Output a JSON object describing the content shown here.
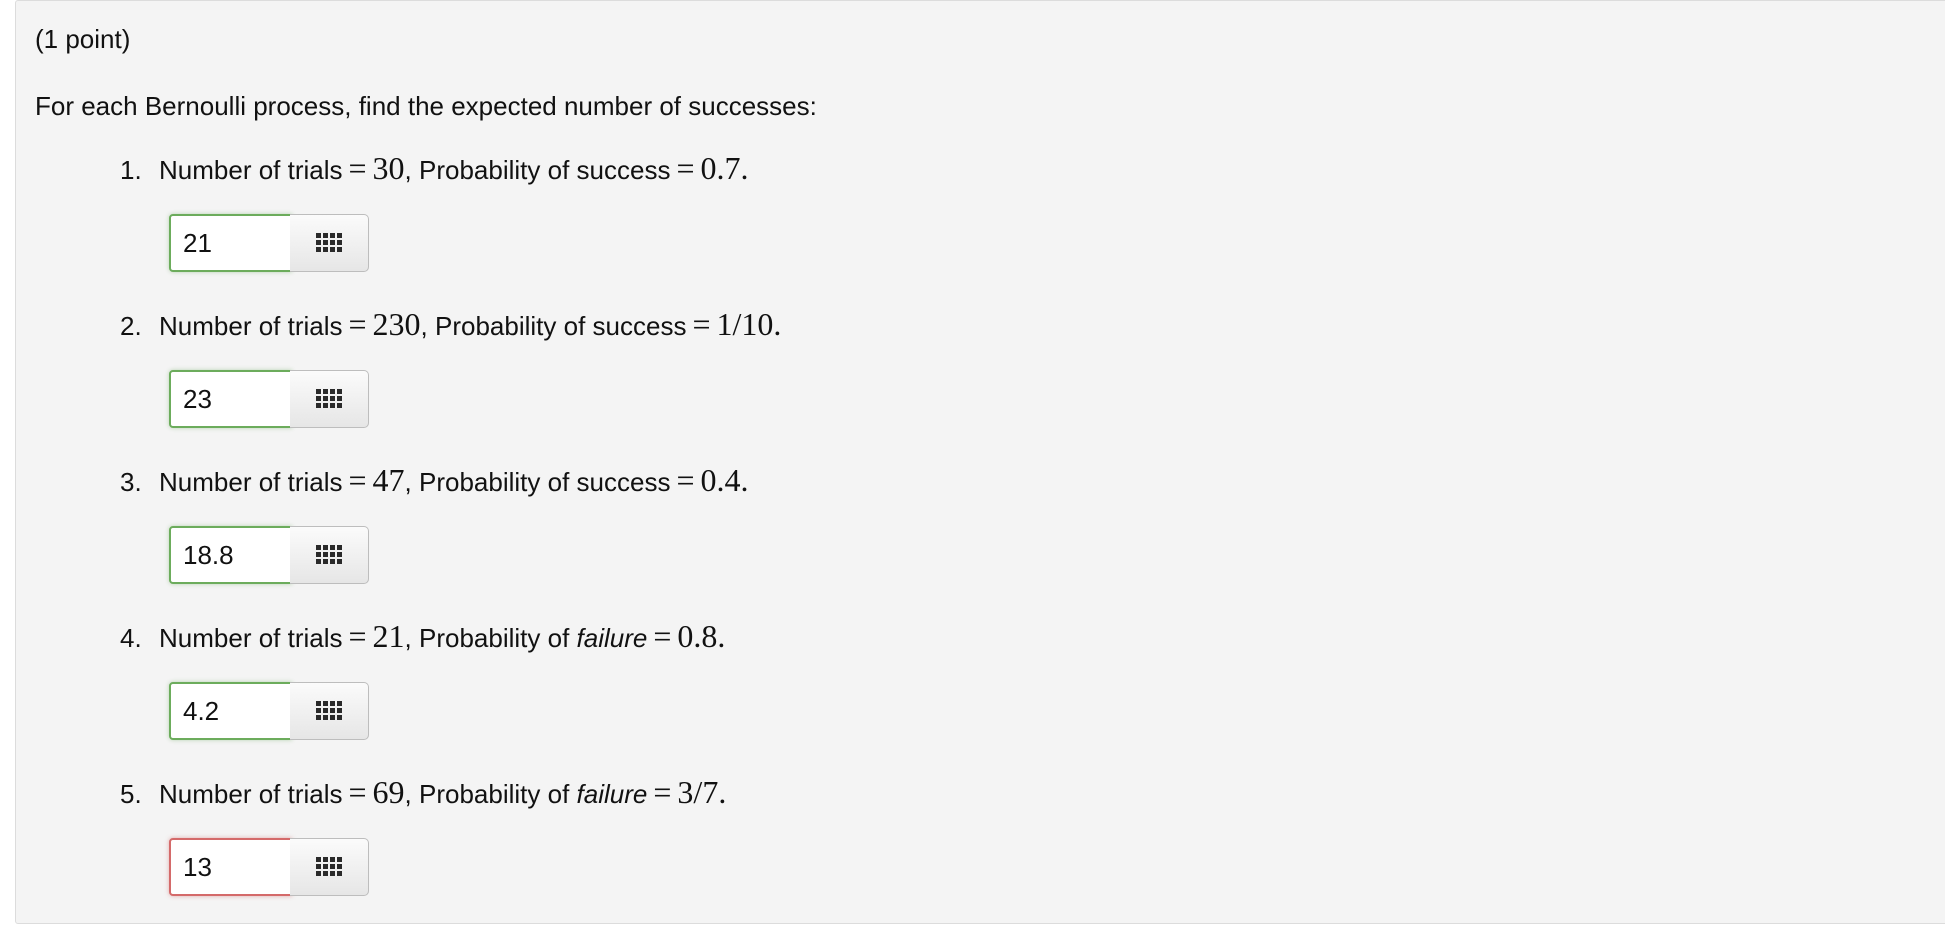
{
  "header": {
    "points_label": "(1 point)"
  },
  "instructions": "For each Bernoulli process, find the expected number of successes:",
  "questions": [
    {
      "number": "1.",
      "trials_label": "Number of trials",
      "trials_value": "30",
      "prob_label": "Probability of",
      "prob_word": "success",
      "prob_word_italic": false,
      "prob_value": "0.7",
      "answer": "21",
      "status": "correct"
    },
    {
      "number": "2.",
      "trials_label": "Number of trials",
      "trials_value": "230",
      "prob_label": "Probability of",
      "prob_word": "success",
      "prob_word_italic": false,
      "prob_value": "1/10",
      "answer": "23",
      "status": "correct"
    },
    {
      "number": "3.",
      "trials_label": "Number of trials",
      "trials_value": "47",
      "prob_label": "Probability of",
      "prob_word": "success",
      "prob_word_italic": false,
      "prob_value": "0.4",
      "answer": "18.8",
      "status": "correct"
    },
    {
      "number": "4.",
      "trials_label": "Number of trials",
      "trials_value": "21",
      "prob_label": "Probability of",
      "prob_word": "failure",
      "prob_word_italic": true,
      "prob_value": "0.8",
      "answer": "4.2",
      "status": "correct"
    },
    {
      "number": "5.",
      "trials_label": "Number of trials",
      "trials_value": "69",
      "prob_label": "Probability of",
      "prob_word": "failure",
      "prob_word_italic": true,
      "prob_value": "3/7",
      "answer": "13",
      "status": "incorrect"
    }
  ],
  "icons": {
    "palette": "equation-palette-grid-icon"
  },
  "colors": {
    "correct_border": "#6cac5c",
    "incorrect_border": "#d46a6a",
    "panel_bg": "#f4f4f4"
  }
}
